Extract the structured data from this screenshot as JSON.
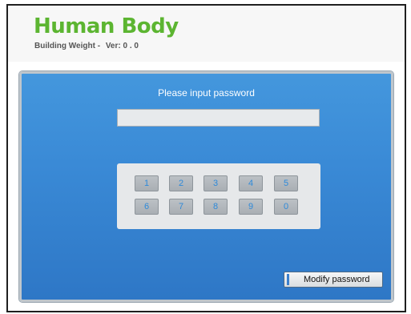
{
  "header": {
    "title": "Human Body",
    "subtitle": "Building Weight -",
    "version": "Ver: 0 . 0"
  },
  "login": {
    "prompt": "Please input password",
    "password_value": "",
    "keys": [
      "1",
      "2",
      "3",
      "4",
      "5",
      "6",
      "7",
      "8",
      "9",
      "0"
    ],
    "modify_label": "Modify password"
  },
  "colors": {
    "brand_green": "#5cb531",
    "panel_blue": "#3a8ad6",
    "key_text": "#2f8ad9"
  }
}
